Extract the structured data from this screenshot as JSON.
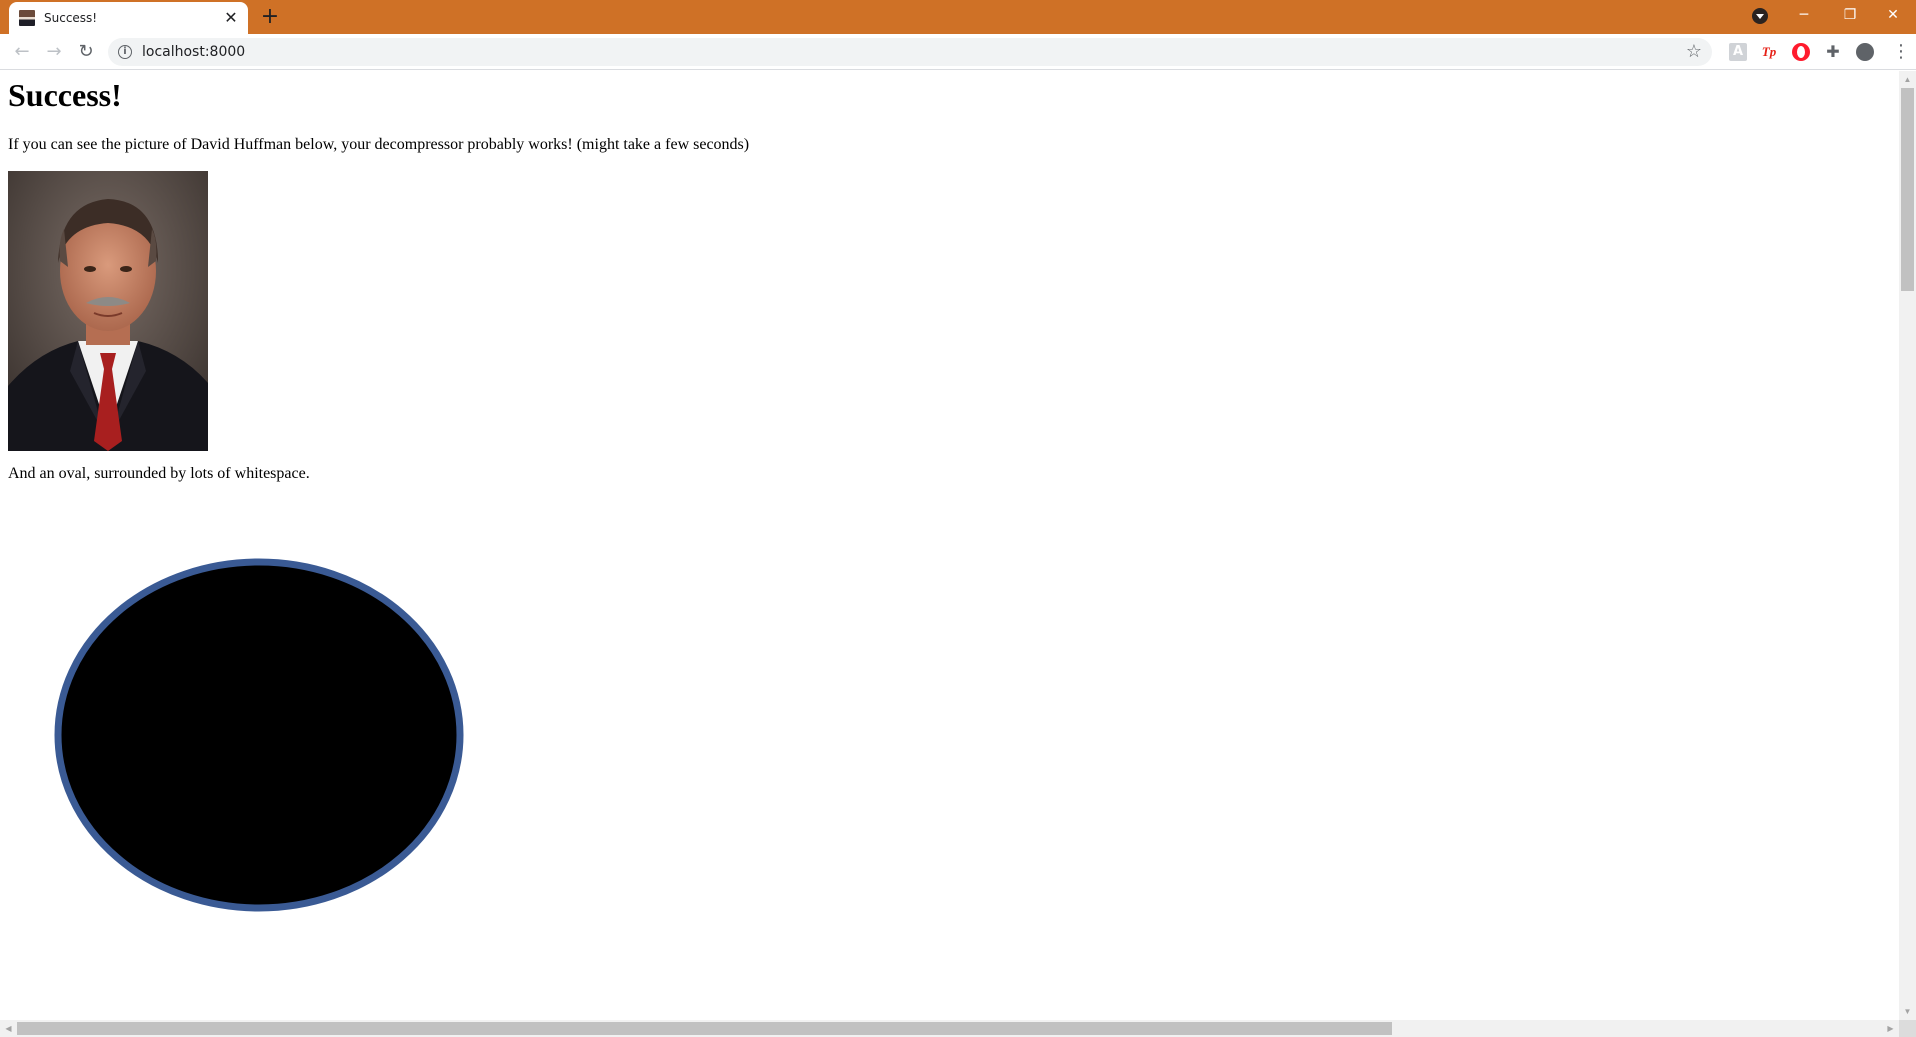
{
  "browser": {
    "tab": {
      "title": "Success!",
      "favicon": "portrait-favicon",
      "close_glyph": "✕"
    },
    "new_tab_glyph": "+",
    "window_controls": {
      "minimize": "─",
      "restore": "❐",
      "close": "✕"
    },
    "address_bar": {
      "url": "localhost:8000"
    },
    "nav": {
      "back": "←",
      "forward": "→",
      "reload": "↻"
    },
    "star_glyph": "☆",
    "extensions": [
      "ext-generic-icon",
      "tampermonkey-icon",
      "opera-icon",
      "puzzle-icon",
      "profile-icon"
    ],
    "accent_color": "#cf7126"
  },
  "page": {
    "title": "Success!",
    "intro": "If you can see the picture of David Huffman below, your decompressor probably works! (might take a few seconds)",
    "oval_caption": "And an oval, surrounded by lots of whitespace.",
    "oval": {
      "fill": "#000000",
      "stroke": "#3a5a94"
    }
  }
}
